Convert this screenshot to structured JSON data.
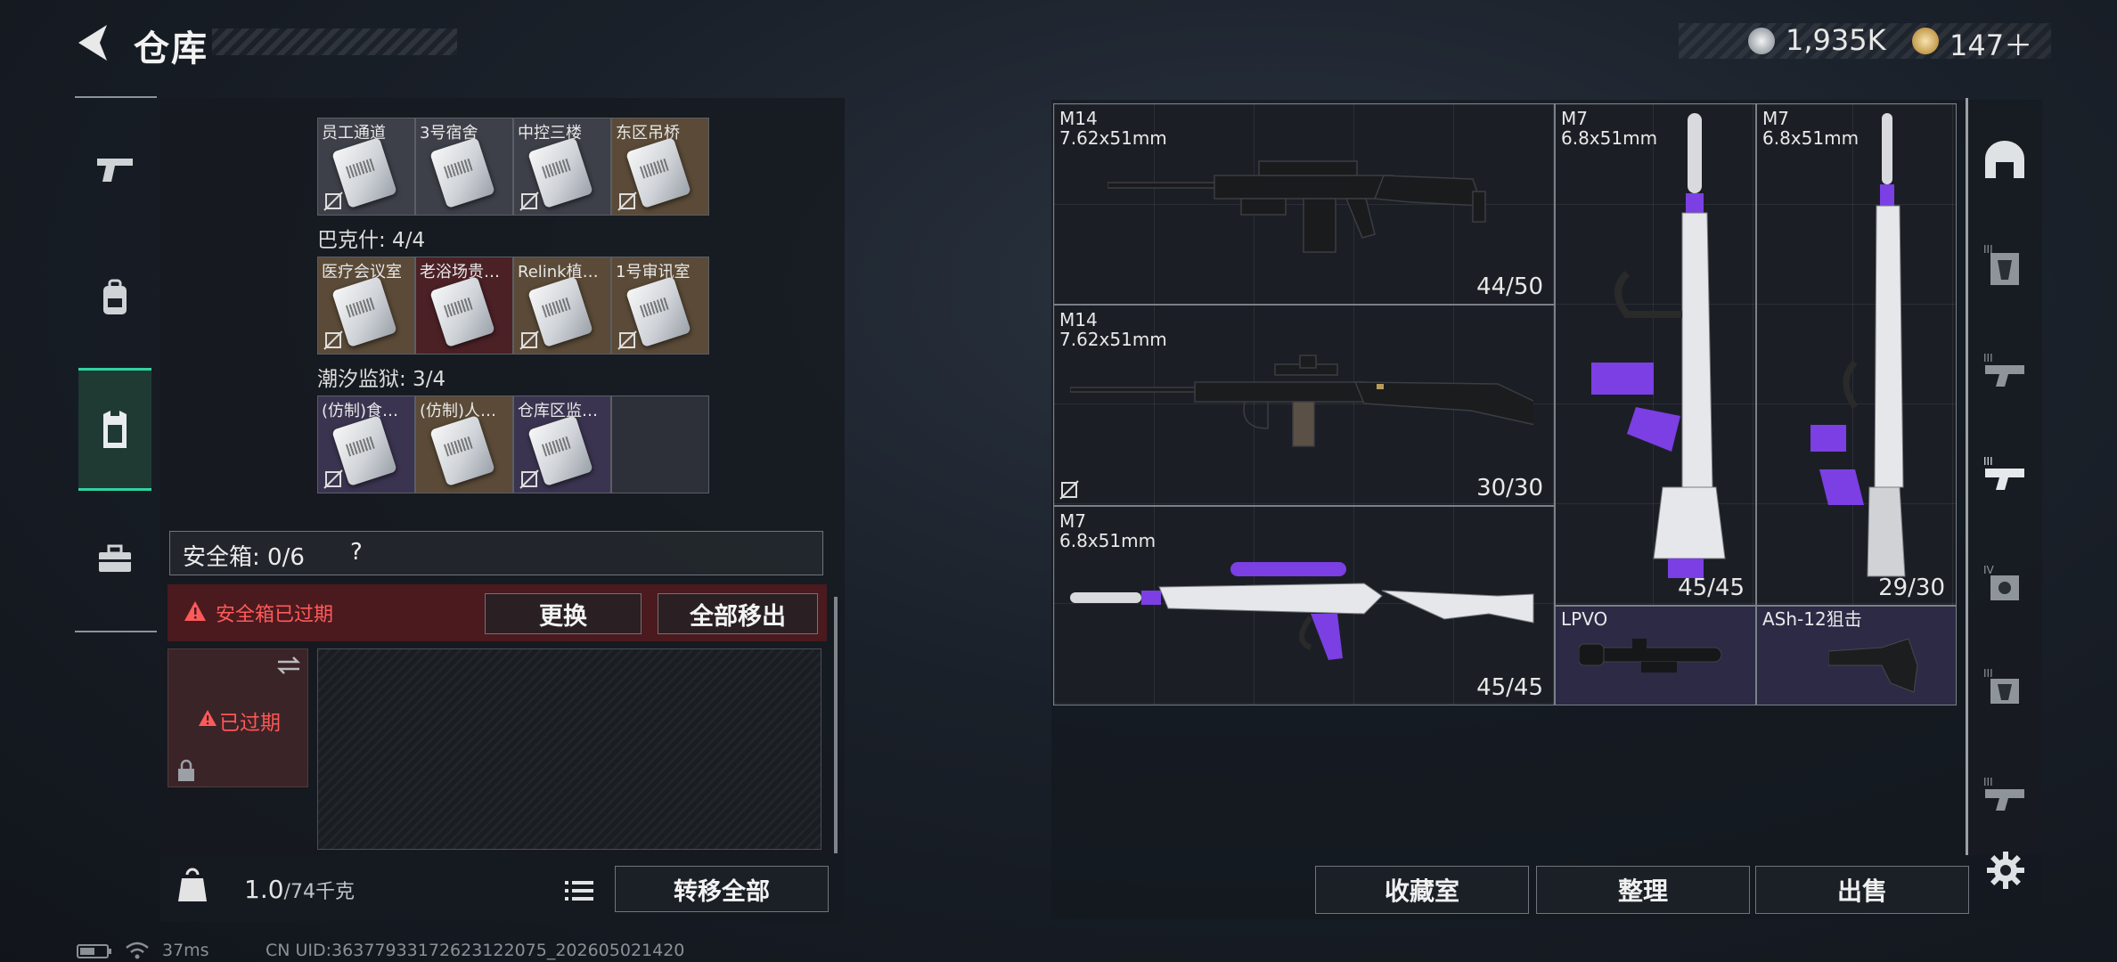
{
  "header": {
    "title": "仓库",
    "currency": [
      {
        "icon": "silver-coin-icon",
        "value": "1,935K"
      },
      {
        "icon": "gold-coin-icon",
        "value": "147＋"
      }
    ]
  },
  "left_rail": [
    {
      "icon": "pistol-icon",
      "active": false
    },
    {
      "icon": "backpack-icon",
      "active": false
    },
    {
      "icon": "vest-icon",
      "active": true
    },
    {
      "icon": "toolbox-icon",
      "active": false
    }
  ],
  "keycard_groups": [
    {
      "label": "",
      "cards": [
        {
          "label": "员工通道",
          "color": "gray"
        },
        {
          "label": "3号宿舍",
          "color": "gray"
        },
        {
          "label": "中控三楼",
          "color": "gray"
        },
        {
          "label": "东区吊桥",
          "color": "tan"
        }
      ]
    },
    {
      "label": "巴克什: 4/4",
      "cards": [
        {
          "label": "医疗会议室",
          "color": "tan"
        },
        {
          "label": "老浴场贵…",
          "color": "red"
        },
        {
          "label": "Relink植…",
          "color": "tan"
        },
        {
          "label": "1号审讯室",
          "color": "tan"
        }
      ]
    },
    {
      "label": "潮汐监狱: 3/4",
      "cards": [
        {
          "label": "(仿制)食…",
          "color": "purple"
        },
        {
          "label": "(仿制)人…",
          "color": "tan"
        },
        {
          "label": "仓库区监…",
          "color": "purple"
        },
        {
          "label": "",
          "color": "empty"
        }
      ]
    }
  ],
  "safe_box": {
    "label": "安全箱: 0/6",
    "help": "?",
    "alert": "安全箱已过期",
    "replace_button": "更换",
    "remove_all_button": "全部移出",
    "expired_label": "已过期"
  },
  "weight": {
    "current": "1.0",
    "max": "/74千克"
  },
  "transfer_all_button": "转移全部",
  "weapons": [
    {
      "name": "M14",
      "caliber": "7.62x51mm",
      "ammo": "44/50"
    },
    {
      "name": "M14",
      "caliber": "7.62x51mm",
      "ammo": "30/30"
    },
    {
      "name": "M7",
      "caliber": "6.8x51mm",
      "ammo": "45/45"
    },
    {
      "name": "M7",
      "caliber": "6.8x51mm",
      "ammo": "45/45"
    },
    {
      "name": "M7",
      "caliber": "6.8x51mm",
      "ammo": "29/30"
    }
  ],
  "attachments": [
    {
      "name": "LPVO"
    },
    {
      "name": "ASh-12狙击"
    }
  ],
  "right_rail": [
    {
      "icon": "helmet-icon"
    },
    {
      "icon": "armor-iii-icon"
    },
    {
      "icon": "backpack-iii-icon"
    },
    {
      "icon": "rig-iii-icon"
    },
    {
      "icon": "armor-iv-icon"
    },
    {
      "icon": "armor-iii-b-icon"
    },
    {
      "icon": "rig-iii-b-icon"
    }
  ],
  "bottom_buttons": {
    "collection": "收藏室",
    "sort": "整理",
    "sell": "出售"
  },
  "status_bar": {
    "ping": "37ms",
    "uid": "CN UID:363779331726231​22075_202605021420"
  },
  "colors": {
    "accent_green": "#2fd3a2",
    "alert_red": "#ff5a5a",
    "purple": "#7b3fe4"
  }
}
